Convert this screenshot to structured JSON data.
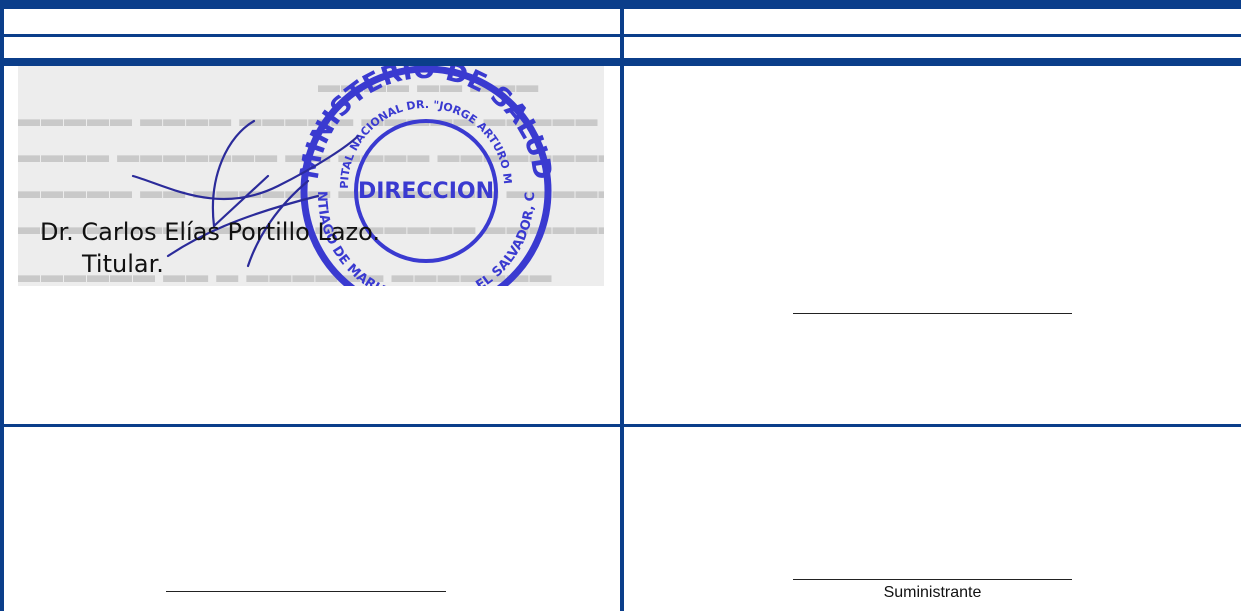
{
  "signatory": {
    "name": "Dr. Carlos Elías Portillo Lazo.",
    "role": "Titular."
  },
  "stamp": {
    "outer_text_top": "MINISTERIO DE SALUD",
    "inner_text_top": "HOSPITAL NACIONAL DR. \"JORGE ARTURO MENA\"",
    "center_text": "DIRECCION",
    "bottom_text": "SANTIAGO DE MARIA, USULUTAN, EL SALVADOR, C.A.",
    "color": "#3a3ad0"
  },
  "supplier_block": {
    "caption": "Suministrante"
  },
  "colors": {
    "rule": "#0b3e8a",
    "stamp": "#3a3ad0",
    "ink": "#2b2b9a"
  }
}
